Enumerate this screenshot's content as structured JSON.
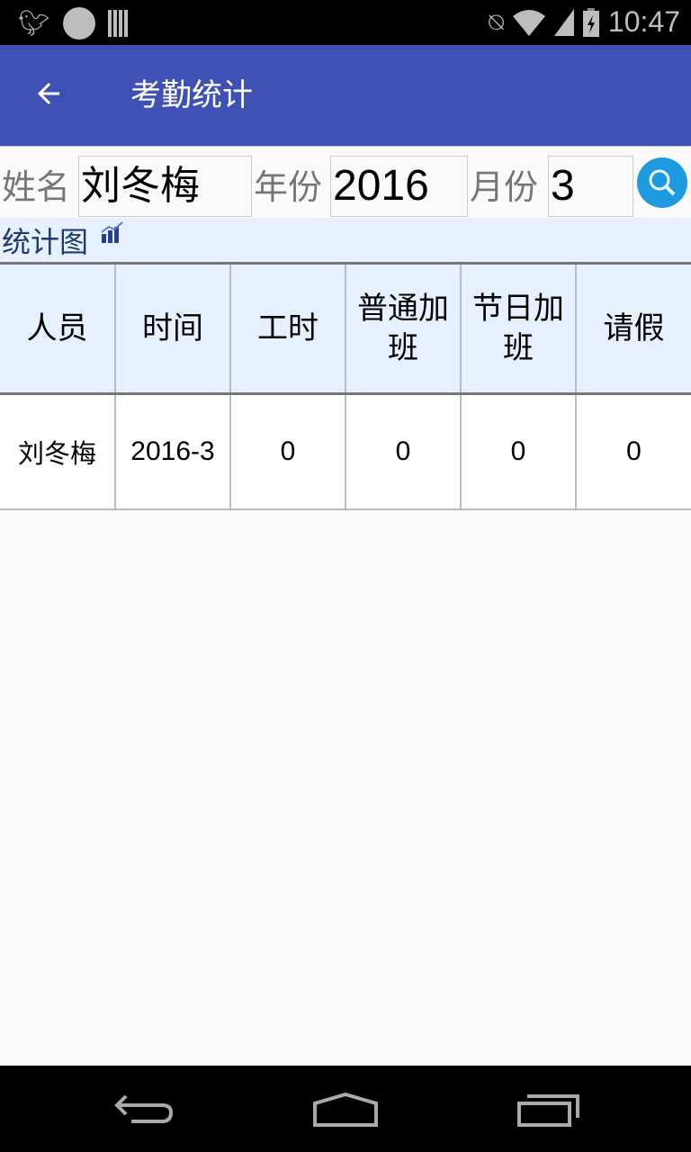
{
  "status_bar": {
    "time": "10:47",
    "left_icons": [
      "twitter-icon",
      "dingtalk-icon",
      "barcode-icon"
    ],
    "right_icons": [
      "mute-icon",
      "wifi-icon",
      "signal-icon",
      "battery-charging-icon"
    ]
  },
  "app_bar": {
    "title": "考勤统计",
    "back_icon": "arrow-back-icon",
    "color": "#3f51b5"
  },
  "form": {
    "name_label": "姓名",
    "name_value": "刘冬梅",
    "year_label": "年份",
    "year_value": "2016",
    "month_label": "月份",
    "month_value": "3",
    "search_icon": "search-icon"
  },
  "chart_link": {
    "label": "统计图",
    "icon": "bar-chart-icon"
  },
  "table": {
    "headers": [
      "人员",
      "时间",
      "工时",
      "普通加班",
      "节日加班",
      "请假"
    ],
    "rows": [
      [
        "刘冬梅",
        "2016-3",
        "0",
        "0",
        "0",
        "0"
      ]
    ]
  },
  "nav_bar": {
    "icons": [
      "back-nav-icon",
      "home-nav-icon",
      "recents-nav-icon"
    ]
  }
}
